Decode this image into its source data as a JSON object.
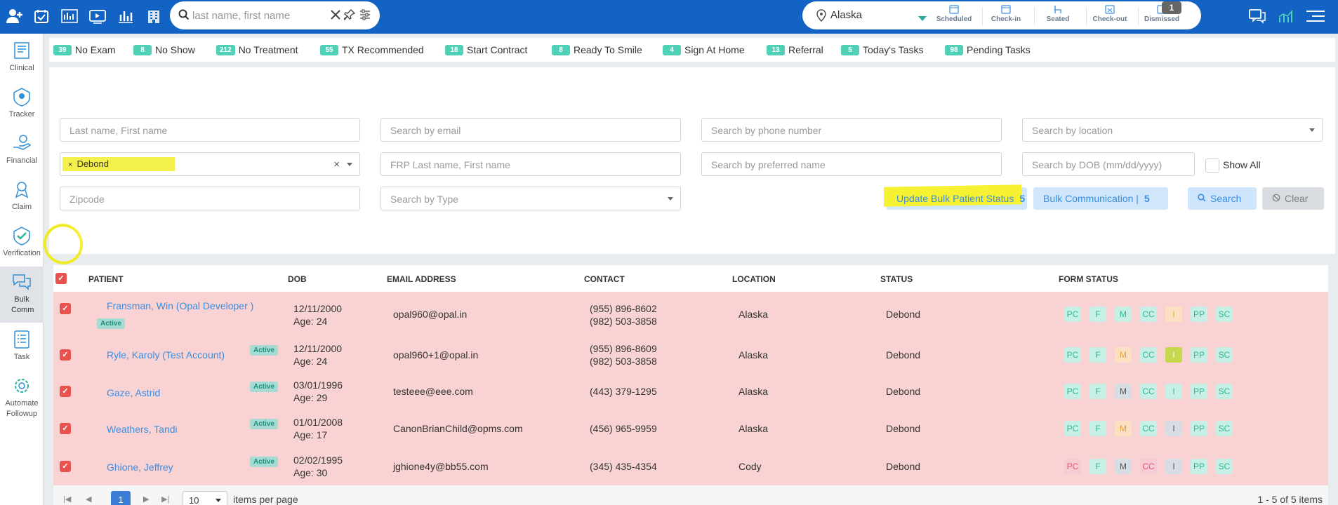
{
  "topbar": {
    "search_placeholder": "last name, first name",
    "location": "Alaska",
    "statuses": [
      {
        "label": "Scheduled",
        "icon": "calendar-icon"
      },
      {
        "label": "Check-in",
        "icon": "calendar-check-icon"
      },
      {
        "label": "Seated",
        "icon": "chair-icon"
      },
      {
        "label": "Check-out",
        "icon": "calendar-x-icon"
      },
      {
        "label": "Dismissed",
        "icon": "calendar-dismiss-icon"
      }
    ],
    "dismissed_count": "1"
  },
  "sidebar": {
    "items": [
      {
        "label": "Clinical"
      },
      {
        "label": "Tracker"
      },
      {
        "label": "Financial"
      },
      {
        "label": "Claim"
      },
      {
        "label": "Verification"
      },
      {
        "label": "Bulk Comm"
      },
      {
        "label": "Task"
      },
      {
        "label": "Automate Followup"
      }
    ]
  },
  "chips": [
    {
      "count": "39",
      "label": "No Exam"
    },
    {
      "count": "8",
      "label": "No Show"
    },
    {
      "count": "212",
      "label": "No Treatment"
    },
    {
      "count": "55",
      "label": "TX Recommended"
    },
    {
      "count": "18",
      "label": "Start Contract"
    },
    {
      "count": "8",
      "label": "Ready To Smile"
    },
    {
      "count": "4",
      "label": "Sign At Home"
    },
    {
      "count": "13",
      "label": "Referral"
    },
    {
      "count": "5",
      "label": "Today's Tasks"
    },
    {
      "count": "98",
      "label": "Pending Tasks"
    }
  ],
  "filters": {
    "name_placeholder": "Last name, First name",
    "email_placeholder": "Search by email",
    "phone_placeholder": "Search by phone number",
    "location_placeholder": "Search by location",
    "status_tag": "Debond",
    "frp_placeholder": "FRP Last name, First name",
    "preferred_placeholder": "Search by preferred name",
    "dob_placeholder": "Search by DOB (mm/dd/yyyy)",
    "show_all_label": "Show All",
    "zipcode_placeholder": "Zipcode",
    "type_placeholder": "Search by Type"
  },
  "actions": {
    "update_label": "Update Bulk Patient Status",
    "update_count": "5",
    "bulk_label": "Bulk Communication |",
    "bulk_count": "5",
    "search_label": "Search",
    "clear_label": "Clear"
  },
  "table": {
    "headers": [
      "PATIENT",
      "DOB",
      "EMAIL ADDRESS",
      "CONTACT",
      "LOCATION",
      "STATUS",
      "FORM STATUS"
    ],
    "rows": [
      {
        "name": "Fransman, Win (Opal Developer )",
        "badge": "Active",
        "dob": "12/11/2000",
        "age": "Age: 24",
        "email": "opal960@opal.in",
        "phone1": "(955) 896-8602",
        "phone2": "(982) 503-3858",
        "location": "Alaska",
        "status": "Debond"
      },
      {
        "name": "Ryle, Karoly (Test Account)",
        "badge": "Active",
        "dob": "12/11/2000",
        "age": "Age: 24",
        "email": "opal960+1@opal.in",
        "phone1": "(955) 896-8609",
        "phone2": "(982) 503-3858",
        "location": "Alaska",
        "status": "Debond"
      },
      {
        "name": "Gaze, Astrid",
        "badge": "Active",
        "dob": "03/01/1996",
        "age": "Age: 29",
        "email": "testeee@eee.com",
        "phone1": "(443) 379-1295",
        "phone2": "",
        "location": "Alaska",
        "status": "Debond"
      },
      {
        "name": "Weathers, Tandi",
        "badge": "Active",
        "dob": "01/01/2008",
        "age": "Age: 17",
        "email": "CanonBrianChild@opms.com",
        "phone1": "(456) 965-9959",
        "phone2": "",
        "location": "Alaska",
        "status": "Debond"
      },
      {
        "name": "Ghione, Jeffrey",
        "badge": "Active",
        "dob": "02/02/1995",
        "age": "Age: 30",
        "email": "jghione4y@bb55.com",
        "phone1": "(345) 435-4354",
        "phone2": "",
        "location": "Cody",
        "status": "Debond"
      }
    ],
    "form_labels": [
      "PC",
      "F",
      "M",
      "CC",
      "I",
      "PP",
      "SC"
    ]
  },
  "pager": {
    "page": "1",
    "page_size": "10",
    "items_label": "items per page",
    "range": "1 - 5 of 5 items"
  }
}
